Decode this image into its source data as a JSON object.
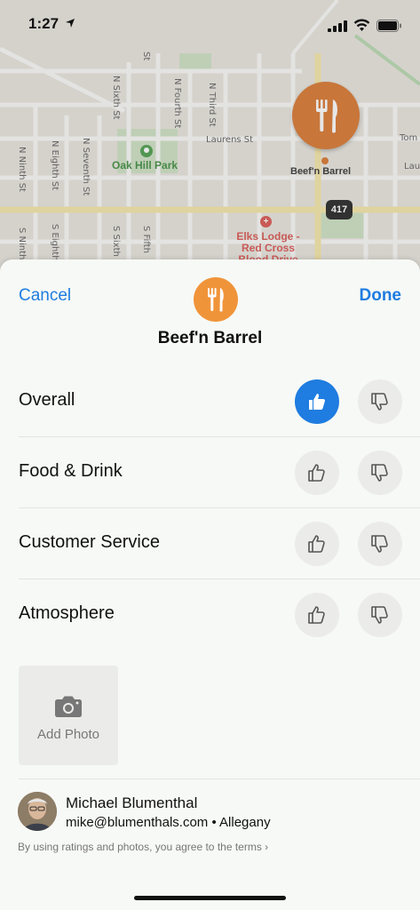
{
  "status_bar": {
    "time": "1:27"
  },
  "map": {
    "streets": {
      "n_ninth": "N Ninth St",
      "n_eighth": "N Eighth St",
      "n_seventh": "N Seventh St",
      "n_sixth": "N Sixth St",
      "st_fragment": "St",
      "n_fourth": "N Fourth St",
      "n_third": "N Third St",
      "laurens": "Laurens St",
      "s_ninth": "S Ninth",
      "s_eighth": "S Eighth",
      "s_sixth": "S Sixth",
      "s_fifth": "S Fifth",
      "tom": "Tom",
      "lau": "Lau"
    },
    "park": "Oak Hill Park",
    "poi_label": "Beef'n Barrel",
    "route_number": "417",
    "elks_label": "Elks Lodge - Red Cross Blood Drive"
  },
  "sheet": {
    "cancel_label": "Cancel",
    "done_label": "Done",
    "title": "Beef'n Barrel",
    "ratings": [
      {
        "label": "Overall",
        "selected": "up"
      },
      {
        "label": "Food & Drink",
        "selected": "none"
      },
      {
        "label": "Customer Service",
        "selected": "none"
      },
      {
        "label": "Atmosphere",
        "selected": "none"
      }
    ],
    "add_photo_label": "Add Photo",
    "user": {
      "name": "Michael Blumenthal",
      "email_location": "mike@blumenthals.com • Allegany"
    },
    "terms": "By using ratings and photos, you agree to the terms ›"
  },
  "colors": {
    "accent": "#1f7ce0",
    "poi": "#d9762d",
    "place_icon": "#f0943a"
  }
}
